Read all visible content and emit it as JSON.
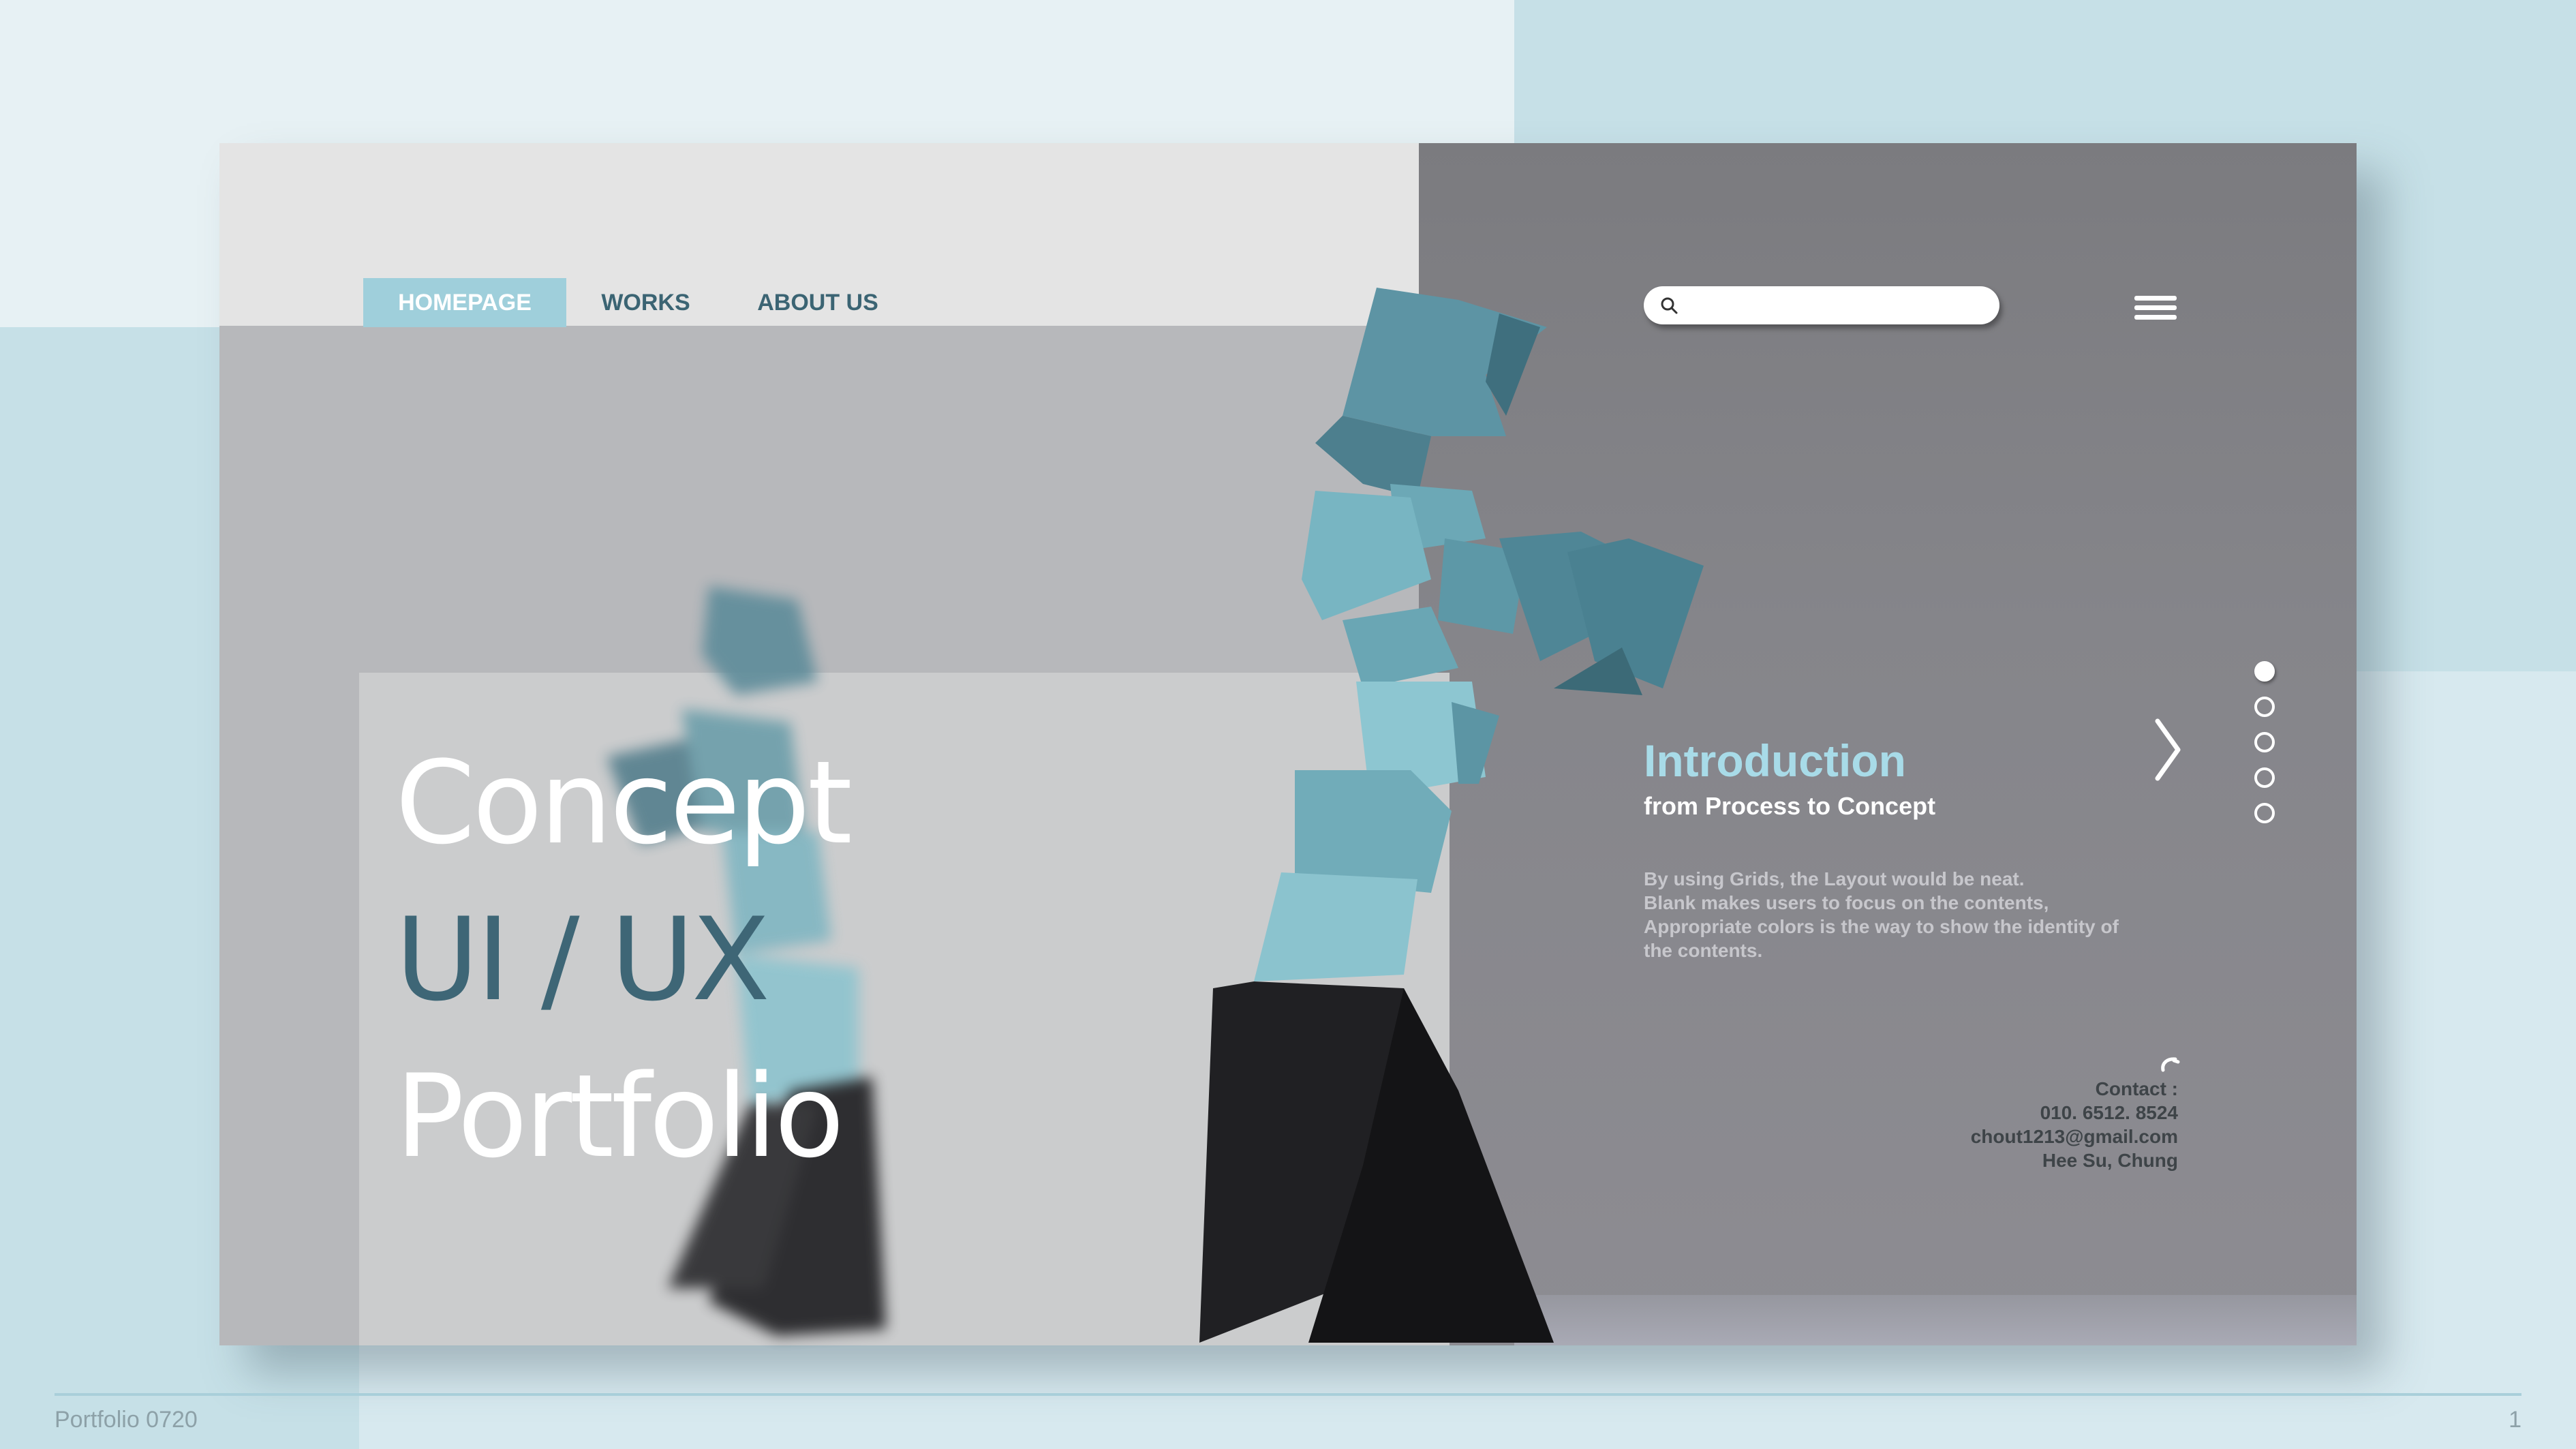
{
  "nav": {
    "items": [
      {
        "label": "HOMEPAGE",
        "active": true
      },
      {
        "label": "WORKS",
        "active": false
      },
      {
        "label": "ABOUT US",
        "active": false
      }
    ]
  },
  "search": {
    "placeholder": "",
    "value": "",
    "icon": "search-icon"
  },
  "menu": {
    "icon": "hamburger-menu-icon"
  },
  "hero": {
    "line1": "Concept",
    "line2": "UI / UX",
    "line3": "Portfolio"
  },
  "intro": {
    "heading": "Introduction",
    "subheading": "from Process to Concept",
    "body": [
      "By using Grids, the Layout would be neat.",
      "Blank makes users to focus on the contents,",
      "Appropriate colors is the way to show the identity of",
      "the contents."
    ],
    "next_icon": "chevron-right-icon"
  },
  "pagination": {
    "total": 5,
    "active_index": 0
  },
  "contact": {
    "icon": "phone-icon",
    "label": "Contact :",
    "phone": "010. 6512. 8524",
    "email": "chout1213@gmail.com",
    "name": "Hee Su, Chung"
  },
  "footer": {
    "left": "Portfolio 0720",
    "page": "1"
  },
  "colors": {
    "accent": "#9fcfdb",
    "nav_text": "#3b6473",
    "heading_blue": "#a8dbe8",
    "title_dark": "#3e6676"
  }
}
